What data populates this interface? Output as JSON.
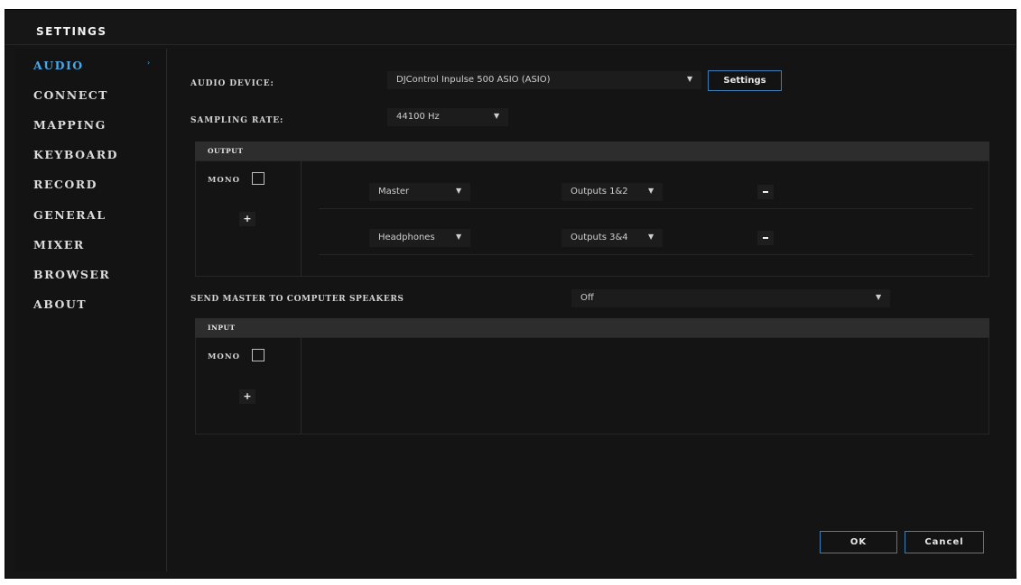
{
  "window": {
    "title": "SETTINGS"
  },
  "sidebar": {
    "items": [
      {
        "label": "AUDIO",
        "active": true,
        "arrow": "›"
      },
      {
        "label": "CONNECT"
      },
      {
        "label": "MAPPING"
      },
      {
        "label": "KEYBOARD"
      },
      {
        "label": "RECORD"
      },
      {
        "label": "GENERAL"
      },
      {
        "label": "MIXER"
      },
      {
        "label": "BROWSER"
      },
      {
        "label": "ABOUT"
      }
    ]
  },
  "audio": {
    "device_label": "AUDIO DEVICE:",
    "device_value": "DJControl Inpulse 500 ASIO (ASIO)",
    "settings_button": "Settings",
    "rate_label": "SAMPLING RATE:",
    "rate_value": "44100 Hz",
    "output": {
      "header": "OUTPUT",
      "mono_label": "MONO",
      "rows": [
        {
          "channel": "Master",
          "outputs": "Outputs 1&2"
        },
        {
          "channel": "Headphones",
          "outputs": "Outputs 3&4"
        }
      ]
    },
    "speakers_label": "SEND MASTER TO COMPUTER SPEAKERS",
    "speakers_value": "Off",
    "input": {
      "header": "INPUT",
      "mono_label": "MONO"
    }
  },
  "footer": {
    "ok_label": "OK",
    "cancel_label": "Cancel"
  },
  "icons": {
    "dropdown": "▼",
    "plus": "+"
  },
  "colors": {
    "accent": "#4aa7e6",
    "button_border": "#3d7fb4",
    "background": "#141414",
    "panel_header": "#2d2d2d"
  }
}
